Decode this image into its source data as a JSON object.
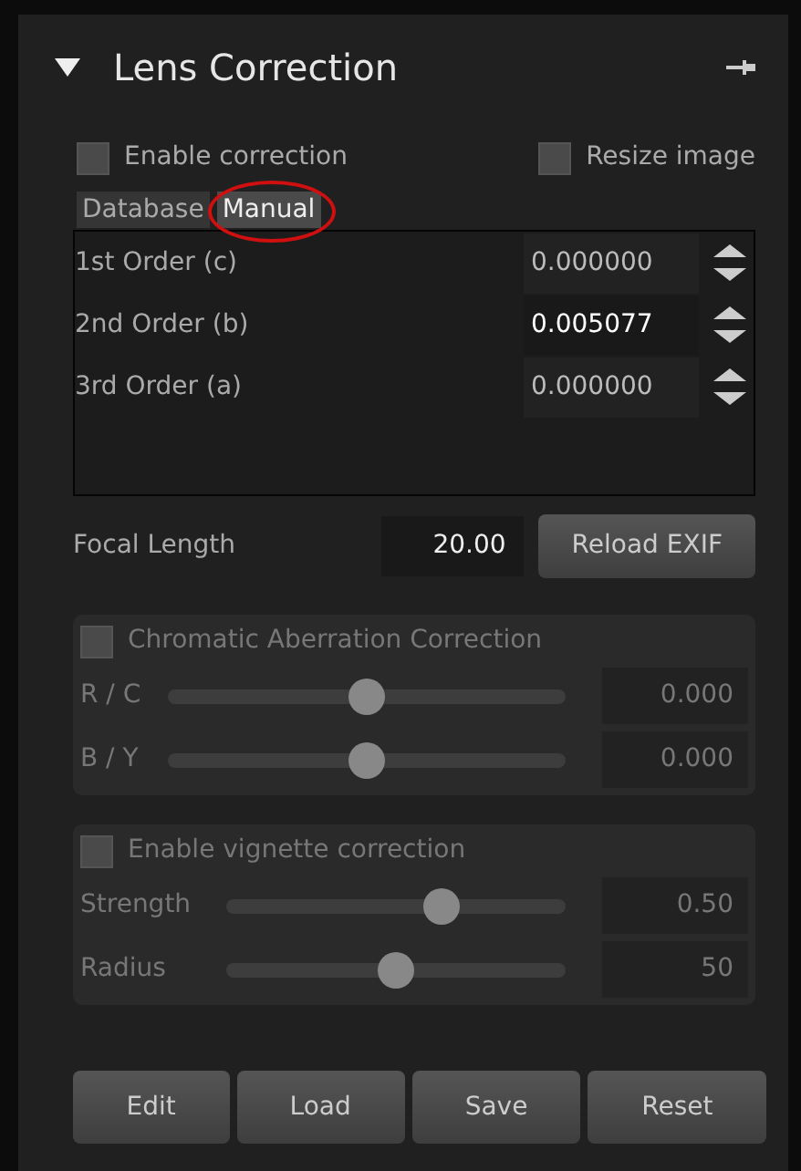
{
  "panel": {
    "title": "Lens Correction",
    "expanded": true
  },
  "options": [
    {
      "label": "Enable correction",
      "checked": false
    },
    {
      "label": "Resize image",
      "checked": false
    }
  ],
  "tabs": [
    {
      "label": "Database",
      "selected": false,
      "circled": false
    },
    {
      "label": "Manual",
      "selected": true,
      "circled": true
    }
  ],
  "coefficients": [
    {
      "label": "1st Order (c)",
      "value": "0.000000",
      "focused": false
    },
    {
      "label": "2nd Order (b)",
      "value": "0.005077",
      "focused": true
    },
    {
      "label": "3rd Order (a)",
      "value": "0.000000",
      "focused": false
    }
  ],
  "focal_length": {
    "label": "Focal Length",
    "value": "20.00",
    "button": "Reload EXIF"
  },
  "groups": [
    {
      "label": "Chromatic Aberration Correction",
      "checked": false,
      "sliders": [
        {
          "label": "R / C",
          "level": 0.5,
          "reading": "0.000"
        },
        {
          "label": "B / Y",
          "level": 0.5,
          "reading": "0.000"
        }
      ]
    },
    {
      "label": "Enable vignette correction",
      "checked": false,
      "sliders": [
        {
          "label": "Strength",
          "level": 0.65,
          "reading": "0.50"
        },
        {
          "label": "Radius",
          "level": 0.5,
          "reading": "50"
        }
      ]
    }
  ],
  "buttons": [
    "Edit",
    "Load",
    "Save",
    "Reset"
  ]
}
